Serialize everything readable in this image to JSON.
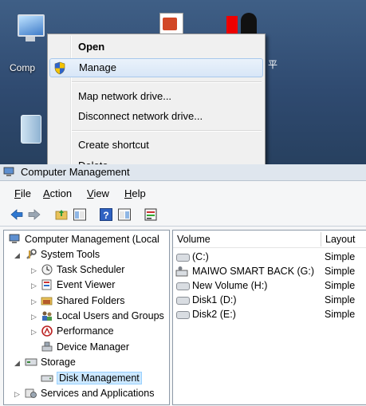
{
  "desktop": {
    "computer_label": "Comp",
    "side_text": "平",
    "context_menu": {
      "items": [
        {
          "label": "Open"
        },
        {
          "label": "Manage"
        },
        {
          "label": "Map network drive..."
        },
        {
          "label": "Disconnect network drive..."
        },
        {
          "label": "Create shortcut"
        },
        {
          "label": "Delete"
        }
      ]
    }
  },
  "window": {
    "title": "Computer Management",
    "menu": [
      {
        "label": "File"
      },
      {
        "label": "Action"
      },
      {
        "label": "View"
      },
      {
        "label": "Help"
      }
    ],
    "tree": [
      {
        "label": "Computer Management (Local"
      },
      {
        "label": "System Tools"
      },
      {
        "label": "Task Scheduler"
      },
      {
        "label": "Event Viewer"
      },
      {
        "label": "Shared Folders"
      },
      {
        "label": "Local Users and Groups"
      },
      {
        "label": "Performance"
      },
      {
        "label": "Device Manager"
      },
      {
        "label": "Storage"
      },
      {
        "label": "Disk Management"
      },
      {
        "label": "Services and Applications"
      }
    ],
    "columns": {
      "volume": "Volume",
      "layout": "Layout"
    },
    "volumes": [
      {
        "name": "(C:)",
        "layout": "Simple"
      },
      {
        "name": "MAIWO SMART BACK (G:)",
        "layout": "Simple"
      },
      {
        "name": "New Volume  (H:)",
        "layout": "Simple"
      },
      {
        "name": "Disk1  (D:)",
        "layout": "Simple"
      },
      {
        "name": "Disk2  (E:)",
        "layout": "Simple"
      }
    ]
  }
}
